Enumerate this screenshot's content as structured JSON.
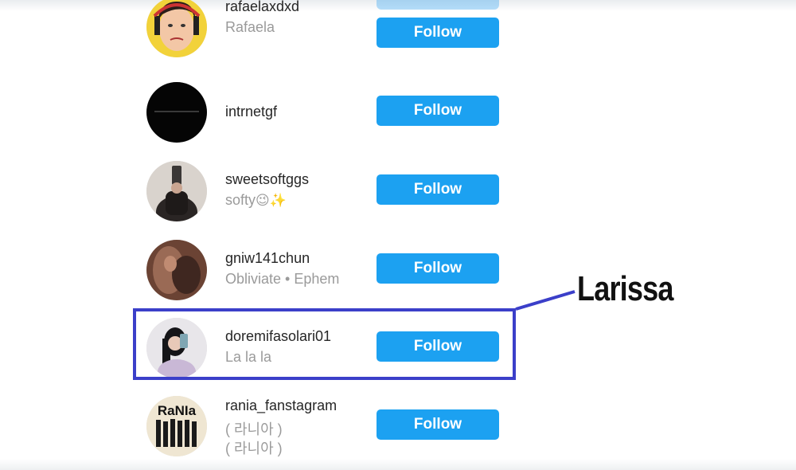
{
  "follow_label": "Follow",
  "accounts": [
    {
      "username": "rafaelaxdxd",
      "full_name": "Rafaela",
      "avatar": "cartoon-face-avatar"
    },
    {
      "username": "intrnetgf",
      "full_name": "",
      "avatar": "black-circle-avatar"
    },
    {
      "username": "sweetsoftggs",
      "full_name": "softy",
      "full_name_emoji": "😉✨",
      "avatar": "mirror-selfie-avatar"
    },
    {
      "username": "gniw141chun",
      "full_name": "Obliviate • Ephem",
      "avatar": "brown-photo-avatar"
    },
    {
      "username": "doremifasolari01",
      "full_name": "La la la",
      "avatar": "girl-selfie-avatar"
    },
    {
      "username": "rania_fanstagram",
      "full_name": "( 라니아 )",
      "full_name_line2": "( 라니아 )",
      "avatar": "rania-group-avatar"
    }
  ],
  "annotation": {
    "label": "Larissa",
    "color": "#3b3fc9"
  },
  "colors": {
    "follow_button": "#1ca1f1",
    "username": "#262626",
    "full_name": "#9a9a9a"
  }
}
